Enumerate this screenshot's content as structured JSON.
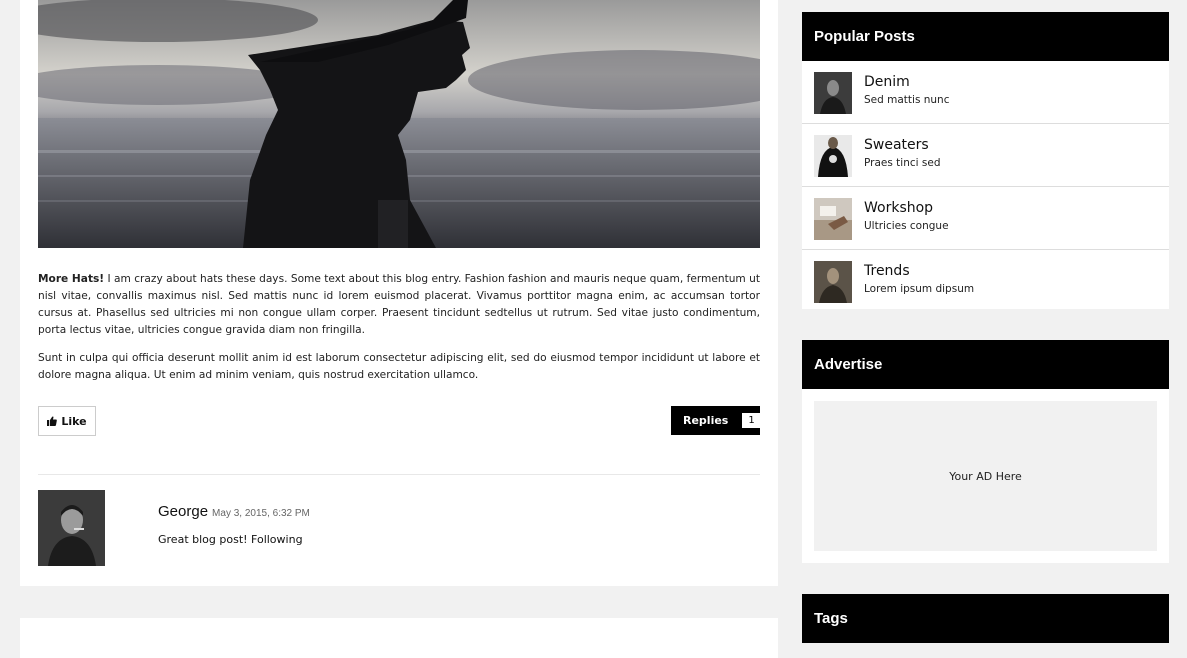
{
  "post": {
    "intro_bold": "More Hats!",
    "paragraph1": " I am crazy about hats these days. Some text about this blog entry. Fashion fashion and mauris neque quam, fermentum ut nisl vitae, convallis maximus nisl. Sed mattis nunc id lorem euismod placerat. Vivamus porttitor magna enim, ac accumsan tortor cursus at. Phasellus sed ultricies mi non congue ullam corper. Praesent tincidunt sedtellus ut rutrum. Sed vitae justo condimentum, porta lectus vitae, ultricies congue gravida diam non fringilla.",
    "paragraph2": "Sunt in culpa qui officia deserunt mollit anim id est laborum consectetur adipiscing elit, sed do eiusmod tempor incididunt ut labore et dolore magna aliqua. Ut enim ad minim veniam, quis nostrud exercitation ullamco.",
    "like_label": "Like",
    "like_icon": "thumbs-up-icon",
    "replies_label": "Replies",
    "replies_count": "1"
  },
  "comment": {
    "author": "George",
    "date": "May 3, 2015, 6:32 PM",
    "text": "Great blog post! Following"
  },
  "sidebar": {
    "popular_title": "Popular Posts",
    "popular_posts": [
      {
        "title": "Denim",
        "subtitle": "Sed mattis nunc"
      },
      {
        "title": "Sweaters",
        "subtitle": "Praes tinci sed"
      },
      {
        "title": "Workshop",
        "subtitle": "Ultricies congue"
      },
      {
        "title": "Trends",
        "subtitle": "Lorem ipsum dipsum"
      }
    ],
    "advertise_title": "Advertise",
    "ad_text": "Your AD Here",
    "tags_title": "Tags"
  },
  "colors": {
    "background": "#f1f1f1",
    "header_black": "#000000",
    "card": "#ffffff"
  }
}
